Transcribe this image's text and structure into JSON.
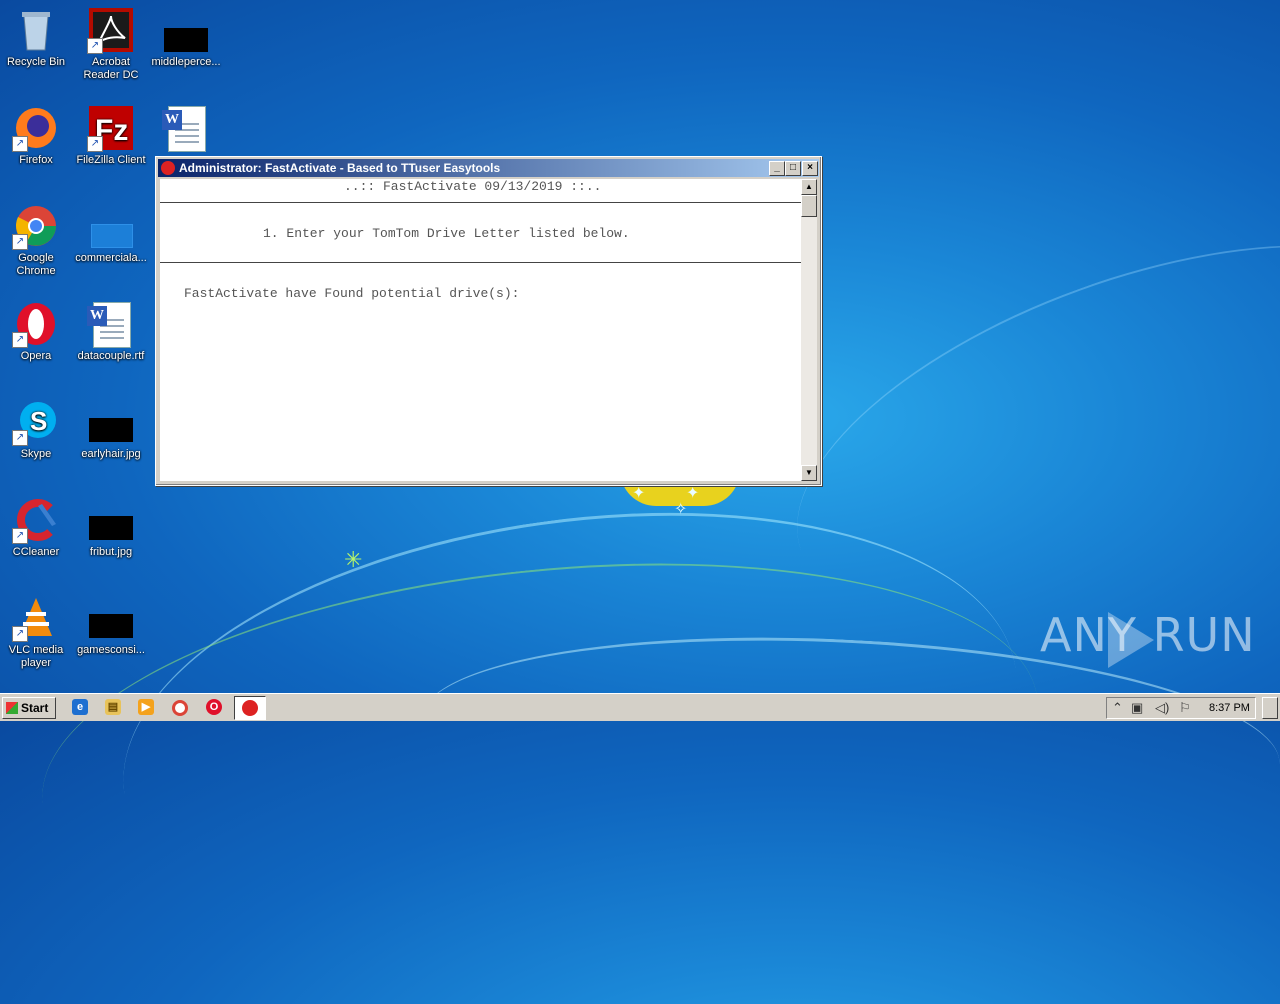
{
  "desktop": {
    "icons": [
      {
        "label": "Recycle Bin",
        "icon": "recycle-bin-icon"
      },
      {
        "label": "Acrobat Reader DC",
        "icon": "acrobat-icon"
      },
      {
        "label": "middleperce...",
        "icon": "file-icon"
      },
      {
        "label": "Firefox",
        "icon": "firefox-icon"
      },
      {
        "label": "FileZilla Client",
        "icon": "filezilla-icon"
      },
      {
        "label": "",
        "icon": "word-doc-icon"
      },
      {
        "label": "Google Chrome",
        "icon": "chrome-icon"
      },
      {
        "label": "commerciala...",
        "icon": "file-icon"
      },
      {
        "label": "Opera",
        "icon": "opera-icon"
      },
      {
        "label": "datacouple.rtf",
        "icon": "word-doc-icon"
      },
      {
        "label": "Skype",
        "icon": "skype-icon"
      },
      {
        "label": "earlyhair.jpg",
        "icon": "image-file-icon"
      },
      {
        "label": "CCleaner",
        "icon": "ccleaner-icon"
      },
      {
        "label": "fribut.jpg",
        "icon": "image-file-icon"
      },
      {
        "label": "VLC media player",
        "icon": "vlc-icon"
      },
      {
        "label": "gamesconsi...",
        "icon": "file-icon"
      }
    ]
  },
  "window": {
    "title": "Administrator:  FastActivate - Based to TTuser Easytools",
    "buttons": {
      "minimize": "_",
      "maximize": "□",
      "close": "×"
    },
    "console": {
      "header": "..:: FastActivate 09/13/2019 ::..",
      "step": "1. Enter your TomTom Drive Letter listed below.",
      "found": "FastActivate have Found potential drive(s):"
    },
    "scroll_up": "▲",
    "scroll_down": "▼"
  },
  "taskbar": {
    "start_label": "Start",
    "quick_launch": [
      "internet-explorer-icon",
      "explorer-icon",
      "media-player-icon",
      "chrome-icon",
      "opera-icon"
    ],
    "active_task_icon": "fastactivate-icon",
    "clock": "8:37 PM"
  },
  "watermark": {
    "text": "ANY    RUN"
  },
  "colors": {
    "titlebar_start": "#0a246a",
    "titlebar_end": "#a6caf0",
    "desktop": "#1a86d6"
  }
}
